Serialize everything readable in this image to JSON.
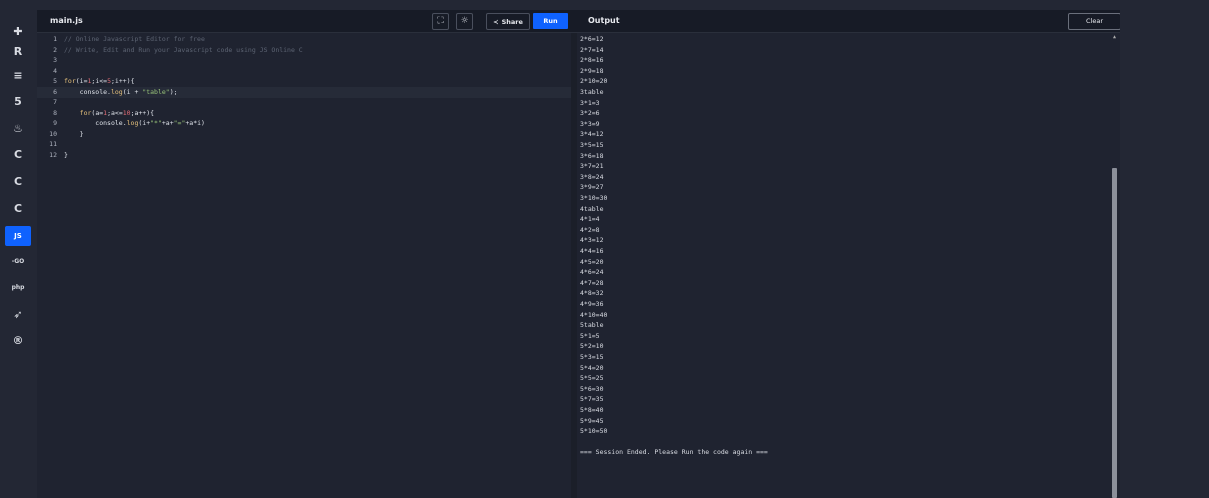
{
  "rail": {
    "items": [
      {
        "name": "python-icon",
        "glyph": "✚"
      },
      {
        "name": "r-icon",
        "glyph": "R"
      },
      {
        "name": "sql-icon",
        "glyph": "≡"
      },
      {
        "name": "html-icon",
        "glyph": "5"
      },
      {
        "name": "java-icon",
        "glyph": "♨"
      },
      {
        "name": "c-icon",
        "glyph": "C"
      },
      {
        "name": "cpp-icon",
        "glyph": "C"
      },
      {
        "name": "csharp-icon",
        "glyph": "C"
      },
      {
        "name": "js-icon",
        "glyph": "JS",
        "active": true
      },
      {
        "name": "go-icon",
        "glyph": "-GO"
      },
      {
        "name": "php-icon",
        "glyph": "php"
      },
      {
        "name": "swift-icon",
        "glyph": "➶"
      },
      {
        "name": "rust-icon",
        "glyph": "®"
      }
    ]
  },
  "header": {
    "tab": "main.js",
    "share_label": "Share",
    "run_label": "Run",
    "output_title": "Output",
    "clear_label": "Clear"
  },
  "editor": {
    "lines": [
      {
        "n": "1",
        "tokens": [
          {
            "t": "// Online Javascript Editor for free",
            "c": "com"
          }
        ]
      },
      {
        "n": "2",
        "tokens": [
          {
            "t": "// Write, Edit and Run your Javascript code using JS Online C",
            "c": "com"
          }
        ]
      },
      {
        "n": "3",
        "tokens": []
      },
      {
        "n": "4",
        "tokens": []
      },
      {
        "n": "5",
        "tokens": [
          {
            "t": "for",
            "c": "kw"
          },
          {
            "t": "(i=",
            "c": ""
          },
          {
            "t": "1",
            "c": "num"
          },
          {
            "t": ";i<=",
            "c": ""
          },
          {
            "t": "5",
            "c": "num"
          },
          {
            "t": ";i++){",
            "c": ""
          }
        ]
      },
      {
        "n": "6",
        "current": true,
        "tokens": [
          {
            "t": "    console.",
            "c": ""
          },
          {
            "t": "log",
            "c": "fn"
          },
          {
            "t": "(i + ",
            "c": ""
          },
          {
            "t": "\"table\"",
            "c": "str"
          },
          {
            "t": ");",
            "c": ""
          }
        ]
      },
      {
        "n": "7",
        "tokens": []
      },
      {
        "n": "8",
        "tokens": [
          {
            "t": "    ",
            "c": ""
          },
          {
            "t": "for",
            "c": "kw"
          },
          {
            "t": "(a=",
            "c": ""
          },
          {
            "t": "1",
            "c": "num"
          },
          {
            "t": ";a<=",
            "c": ""
          },
          {
            "t": "10",
            "c": "num"
          },
          {
            "t": ";a++){",
            "c": ""
          }
        ]
      },
      {
        "n": "9",
        "tokens": [
          {
            "t": "        console.",
            "c": ""
          },
          {
            "t": "log",
            "c": "fn"
          },
          {
            "t": "(i+",
            "c": ""
          },
          {
            "t": "\"*\"",
            "c": "str"
          },
          {
            "t": "+a+",
            "c": ""
          },
          {
            "t": "\"=\"",
            "c": "str"
          },
          {
            "t": "+a*i)",
            "c": ""
          }
        ]
      },
      {
        "n": "10",
        "tokens": [
          {
            "t": "    }",
            "c": ""
          }
        ]
      },
      {
        "n": "11",
        "tokens": []
      },
      {
        "n": "12",
        "tokens": [
          {
            "t": "}",
            "c": ""
          }
        ]
      }
    ]
  },
  "output": {
    "lines": [
      "2*6=12",
      "2*7=14",
      "2*8=16",
      "2*9=18",
      "2*10=20",
      "3table",
      "3*1=3",
      "3*2=6",
      "3*3=9",
      "3*4=12",
      "3*5=15",
      "3*6=18",
      "3*7=21",
      "3*8=24",
      "3*9=27",
      "3*10=30",
      "4table",
      "4*1=4",
      "4*2=8",
      "4*3=12",
      "4*4=16",
      "4*5=20",
      "4*6=24",
      "4*7=28",
      "4*8=32",
      "4*9=36",
      "4*10=40",
      "5table",
      "5*1=5",
      "5*2=10",
      "5*3=15",
      "5*4=20",
      "5*5=25",
      "5*6=30",
      "5*7=35",
      "5*8=40",
      "5*9=45",
      "5*10=50",
      "",
      "=== Session Ended. Please Run the code again ==="
    ]
  },
  "colors": {
    "accent": "#0f62fe",
    "background": "#1f2330",
    "rail": "#232734"
  }
}
